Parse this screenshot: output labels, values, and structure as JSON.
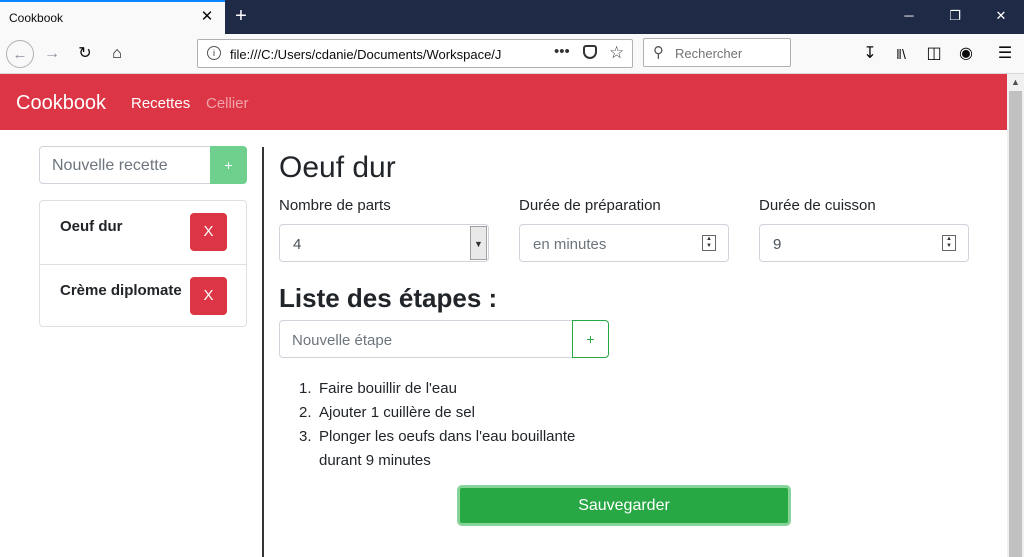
{
  "browser": {
    "tab_title": "Cookbook",
    "tab_close": "✕",
    "new_tab": "+",
    "url": "file:///C:/Users/cdanie/Documents/Workspace/J",
    "search_placeholder": "Rechercher",
    "window_controls": {
      "minimize": "─",
      "restore": "❐",
      "close": "✕"
    }
  },
  "app": {
    "brand": "Cookbook",
    "nav": {
      "recipes": "Recettes",
      "cellar": "Cellier"
    },
    "colors": {
      "primary": "#dc3545",
      "success": "#28a745"
    }
  },
  "sidebar": {
    "new_recipe_placeholder": "Nouvelle recette",
    "add_label": "+",
    "recipes": [
      {
        "name": "Oeuf dur",
        "delete_label": "X"
      },
      {
        "name": "Crème diplomate",
        "delete_label": "X"
      }
    ]
  },
  "main": {
    "title": "Oeuf dur",
    "servings": {
      "label": "Nombre de parts",
      "value": "4"
    },
    "prep_time": {
      "label": "Durée de préparation",
      "placeholder": "en minutes"
    },
    "cook_time": {
      "label": "Durée de cuisson",
      "value": "9"
    },
    "steps_title": "Liste des étapes :",
    "new_step_placeholder": "Nouvelle étape",
    "add_step_label": "+",
    "steps": [
      {
        "num": "1.",
        "text": "Faire bouillir de l'eau"
      },
      {
        "num": "2.",
        "text": "Ajouter 1 cuillère de sel"
      },
      {
        "num": "3.",
        "text": "Plonger les oeufs dans l'eau bouillante durant 9 minutes"
      }
    ],
    "save_label": "Sauvegarder"
  }
}
